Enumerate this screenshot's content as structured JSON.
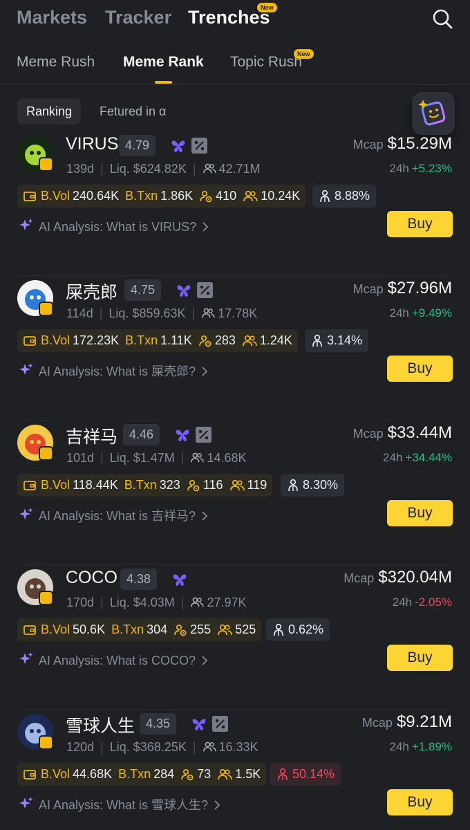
{
  "top_nav": {
    "tabs": [
      "Markets",
      "Tracker",
      "Trenches"
    ],
    "new_badge": "New",
    "active": "Trenches"
  },
  "sub_nav": {
    "tabs": [
      "Meme Rush",
      "Meme Rank",
      "Topic Rush"
    ],
    "new_badge": "New",
    "active": "Meme Rank"
  },
  "filters": [
    "Ranking",
    "Fetured in α"
  ],
  "labels": {
    "mcap": "Mcap",
    "change": "24h",
    "bvol": "B.Vol",
    "btxn": "B.Txn",
    "buy": "Buy",
    "ai_prefix": "AI Analysis: What is "
  },
  "colors": {
    "accent": "#f0b90b",
    "up": "#2ebd85",
    "down": "#f6465d",
    "buy": "#fcd535"
  },
  "tokens": [
    {
      "name": "VIRUS",
      "score": "4.79",
      "mcap": "$15.29M",
      "age": "139d",
      "liq": "Liq. $624.82K",
      "holders": "42.71M",
      "change": "+5.23%",
      "bvol": "240.64K",
      "btxn": "1.86K",
      "snipers": "410",
      "traders": "10.24K",
      "top_holders": "8.88%",
      "ai": "AI Analysis: What is VIRUS?"
    },
    {
      "name": "屎壳郎",
      "score": "4.75",
      "mcap": "$27.96M",
      "age": "114d",
      "liq": "Liq. $859.63K",
      "holders": "17.78K",
      "change": "+9.49%",
      "bvol": "172.23K",
      "btxn": "1.11K",
      "snipers": "283",
      "traders": "1.24K",
      "top_holders": "3.14%",
      "ai": "AI Analysis: What is 屎壳郎?"
    },
    {
      "name": "吉祥马",
      "score": "4.46",
      "mcap": "$33.44M",
      "age": "101d",
      "liq": "Liq. $1.47M",
      "holders": "14.68K",
      "change": "+34.44%",
      "bvol": "118.44K",
      "btxn": "323",
      "snipers": "116",
      "traders": "119",
      "top_holders": "8.30%",
      "ai": "AI Analysis: What is 吉祥马?"
    },
    {
      "name": "COCO",
      "score": "4.38",
      "mcap": "$320.04M",
      "age": "170d",
      "liq": "Liq. $4.03M",
      "holders": "27.97K",
      "change": "-2.05%",
      "bvol": "50.6K",
      "btxn": "304",
      "snipers": "255",
      "traders": "525",
      "top_holders": "0.62%",
      "ai": "AI Analysis: What is COCO?"
    },
    {
      "name": "雪球人生",
      "score": "4.35",
      "mcap": "$9.21M",
      "age": "120d",
      "liq": "Liq. $368.25K",
      "holders": "16.33K",
      "change": "+1.89%",
      "bvol": "44.68K",
      "btxn": "284",
      "snipers": "73",
      "traders": "1.5K",
      "top_holders": "50.14%",
      "ai": "AI Analysis: What is 雪球人生?"
    }
  ]
}
